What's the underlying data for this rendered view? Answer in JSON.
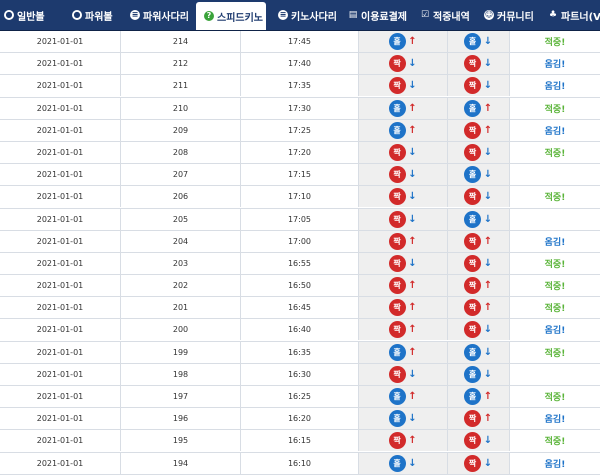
{
  "nav": {
    "items": [
      {
        "label": "일반볼",
        "icon": "ball-icon"
      },
      {
        "label": "파워볼",
        "icon": "ball-icon"
      },
      {
        "label": "파워사다리",
        "icon": "ladder-icon"
      },
      {
        "label": "스피드키노",
        "icon": "keno-icon",
        "active": true
      },
      {
        "label": "키노사다리",
        "icon": "ladder-icon"
      },
      {
        "label": "이용료결제",
        "icon": "payment-icon"
      },
      {
        "label": "적중내역",
        "icon": "check-icon"
      },
      {
        "label": "커뮤니티",
        "icon": "community-icon"
      },
      {
        "label": "파트너(V",
        "icon": "partner-icon"
      }
    ]
  },
  "table": {
    "rows": [
      {
        "date": "2021-01-01",
        "round": "214",
        "time": "17:45",
        "r1": {
          "ball": "홀",
          "color": "blue",
          "arrow": "up"
        },
        "r2": {
          "ball": "홀",
          "color": "blue",
          "arrow": "down"
        },
        "result": "적중!",
        "status": "hit"
      },
      {
        "date": "2021-01-01",
        "round": "212",
        "time": "17:40",
        "r1": {
          "ball": "짝",
          "color": "red",
          "arrow": "down"
        },
        "r2": {
          "ball": "짝",
          "color": "red",
          "arrow": "down"
        },
        "result": "옴김!",
        "status": "miss"
      },
      {
        "date": "2021-01-01",
        "round": "211",
        "time": "17:35",
        "r1": {
          "ball": "짝",
          "color": "red",
          "arrow": "down"
        },
        "r2": {
          "ball": "짝",
          "color": "red",
          "arrow": "down"
        },
        "result": "옴김!",
        "status": "miss"
      },
      {
        "date": "2021-01-01",
        "round": "210",
        "time": "17:30",
        "r1": {
          "ball": "홀",
          "color": "blue",
          "arrow": "up"
        },
        "r2": {
          "ball": "홀",
          "color": "blue",
          "arrow": "up"
        },
        "result": "적중!",
        "status": "hit"
      },
      {
        "date": "2021-01-01",
        "round": "209",
        "time": "17:25",
        "r1": {
          "ball": "홀",
          "color": "blue",
          "arrow": "up"
        },
        "r2": {
          "ball": "짝",
          "color": "red",
          "arrow": "up"
        },
        "result": "옴김!",
        "status": "miss"
      },
      {
        "date": "2021-01-01",
        "round": "208",
        "time": "17:20",
        "r1": {
          "ball": "짝",
          "color": "red",
          "arrow": "down"
        },
        "r2": {
          "ball": "짝",
          "color": "red",
          "arrow": "down"
        },
        "result": "적중!",
        "status": "hit"
      },
      {
        "date": "2021-01-01",
        "round": "207",
        "time": "17:15",
        "r1": {
          "ball": "짝",
          "color": "red",
          "arrow": "down"
        },
        "r2": {
          "ball": "홀",
          "color": "blue",
          "arrow": "down"
        },
        "result": "",
        "status": ""
      },
      {
        "date": "2021-01-01",
        "round": "206",
        "time": "17:10",
        "r1": {
          "ball": "짝",
          "color": "red",
          "arrow": "down"
        },
        "r2": {
          "ball": "짝",
          "color": "red",
          "arrow": "down"
        },
        "result": "적중!",
        "status": "hit"
      },
      {
        "date": "2021-01-01",
        "round": "205",
        "time": "17:05",
        "r1": {
          "ball": "짝",
          "color": "red",
          "arrow": "down"
        },
        "r2": {
          "ball": "홀",
          "color": "blue",
          "arrow": "down"
        },
        "result": "",
        "status": ""
      },
      {
        "date": "2021-01-01",
        "round": "204",
        "time": "17:00",
        "r1": {
          "ball": "짝",
          "color": "red",
          "arrow": "up"
        },
        "r2": {
          "ball": "짝",
          "color": "red",
          "arrow": "up"
        },
        "result": "옴김!",
        "status": "miss"
      },
      {
        "date": "2021-01-01",
        "round": "203",
        "time": "16:55",
        "r1": {
          "ball": "짝",
          "color": "red",
          "arrow": "down"
        },
        "r2": {
          "ball": "짝",
          "color": "red",
          "arrow": "down"
        },
        "result": "적중!",
        "status": "hit"
      },
      {
        "date": "2021-01-01",
        "round": "202",
        "time": "16:50",
        "r1": {
          "ball": "짝",
          "color": "red",
          "arrow": "up"
        },
        "r2": {
          "ball": "짝",
          "color": "red",
          "arrow": "up"
        },
        "result": "적중!",
        "status": "hit"
      },
      {
        "date": "2021-01-01",
        "round": "201",
        "time": "16:45",
        "r1": {
          "ball": "짝",
          "color": "red",
          "arrow": "up"
        },
        "r2": {
          "ball": "짝",
          "color": "red",
          "arrow": "up"
        },
        "result": "적중!",
        "status": "hit"
      },
      {
        "date": "2021-01-01",
        "round": "200",
        "time": "16:40",
        "r1": {
          "ball": "짝",
          "color": "red",
          "arrow": "up"
        },
        "r2": {
          "ball": "짝",
          "color": "red",
          "arrow": "down"
        },
        "result": "옴김!",
        "status": "miss"
      },
      {
        "date": "2021-01-01",
        "round": "199",
        "time": "16:35",
        "r1": {
          "ball": "홀",
          "color": "blue",
          "arrow": "up"
        },
        "r2": {
          "ball": "홀",
          "color": "blue",
          "arrow": "down"
        },
        "result": "적중!",
        "status": "hit"
      },
      {
        "date": "2021-01-01",
        "round": "198",
        "time": "16:30",
        "r1": {
          "ball": "짝",
          "color": "red",
          "arrow": "down"
        },
        "r2": {
          "ball": "홀",
          "color": "blue",
          "arrow": "down"
        },
        "result": "",
        "status": ""
      },
      {
        "date": "2021-01-01",
        "round": "197",
        "time": "16:25",
        "r1": {
          "ball": "홀",
          "color": "blue",
          "arrow": "up"
        },
        "r2": {
          "ball": "홀",
          "color": "blue",
          "arrow": "up"
        },
        "result": "적중!",
        "status": "hit"
      },
      {
        "date": "2021-01-01",
        "round": "196",
        "time": "16:20",
        "r1": {
          "ball": "홀",
          "color": "blue",
          "arrow": "down"
        },
        "r2": {
          "ball": "짝",
          "color": "red",
          "arrow": "up"
        },
        "result": "옴김!",
        "status": "miss"
      },
      {
        "date": "2021-01-01",
        "round": "195",
        "time": "16:15",
        "r1": {
          "ball": "짝",
          "color": "red",
          "arrow": "up"
        },
        "r2": {
          "ball": "짝",
          "color": "red",
          "arrow": "down"
        },
        "result": "적중!",
        "status": "hit"
      },
      {
        "date": "2021-01-01",
        "round": "194",
        "time": "16:10",
        "r1": {
          "ball": "홀",
          "color": "blue",
          "arrow": "down"
        },
        "r2": {
          "ball": "짝",
          "color": "red",
          "arrow": "down"
        },
        "result": "옴김!",
        "status": "miss"
      }
    ]
  },
  "glyphs": {
    "up": "↑",
    "down": "↓"
  }
}
